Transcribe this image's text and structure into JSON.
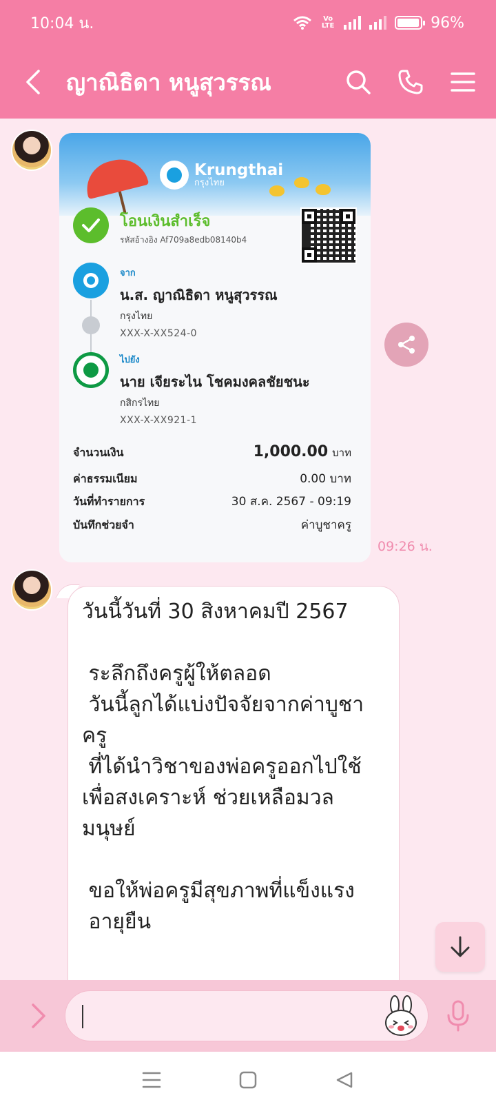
{
  "status_bar": {
    "time": "10:04 น.",
    "volte": "Vo LTE",
    "battery": "96%",
    "battery_level": 0.96
  },
  "header": {
    "title": "ญาณิธิดา หนูสุวรรณ",
    "icons": [
      "chevron-left-icon",
      "search-icon",
      "phone-icon",
      "menu-icon"
    ]
  },
  "receipt": {
    "brand": "Krungthai",
    "brand_sub": "กรุงไทย",
    "status": "โอนเงินสำเร็จ",
    "ref": "รหัสอ้างอิง Af709a8edb08140b4",
    "from_label": "จาก",
    "from_name": "น.ส. ญาณิธิดา หนูสุวรรณ",
    "from_bank": "กรุงไทย",
    "from_account": "XXX-X-XX524-0",
    "to_label": "ไปยัง",
    "to_name": "นาย เจียระไน โชคมงคลชัยชนะ",
    "to_bank": "กสิกรไทย",
    "to_account": "XXX-X-XX921-1",
    "amount_label": "จำนวนเงิน",
    "amount_value": "1,000.00",
    "amount_unit": "บาท",
    "fee_label": "ค่าธรรมเนียม",
    "fee_value": "0.00 บาท",
    "date_label": "วันที่ทำรายการ",
    "date_value": "30 ส.ค. 2567 - 09:19",
    "memo_label": "บันทึกช่วยจำ",
    "memo_value": "ค่าบูชาครู"
  },
  "messages": {
    "image_timestamp": "09:26 น.",
    "text": "วันนี้วันที่ 30 สิงหาคมปี 2567\n\n ระลึกถึงครูผู้ให้ตลอด\n วันนี้ลูกได้แบ่งปัจจัยจากค่าบูชาครู\n ที่ได้นำวิชาของพ่อครูออกไปใช้\nเพื่อสงเคราะห์ ช่วยเหลือมวลมนุษย์\n\n ขอให้พ่อครูมีสุขภาพที่แข็งแรง\n อายุยืน"
  },
  "colors": {
    "header": "#f57ea5",
    "chat_bg": "#fde8f0",
    "input_bar": "#f7c7d7",
    "timestamp": "#f08cae",
    "success_green": "#5cbd2c"
  }
}
